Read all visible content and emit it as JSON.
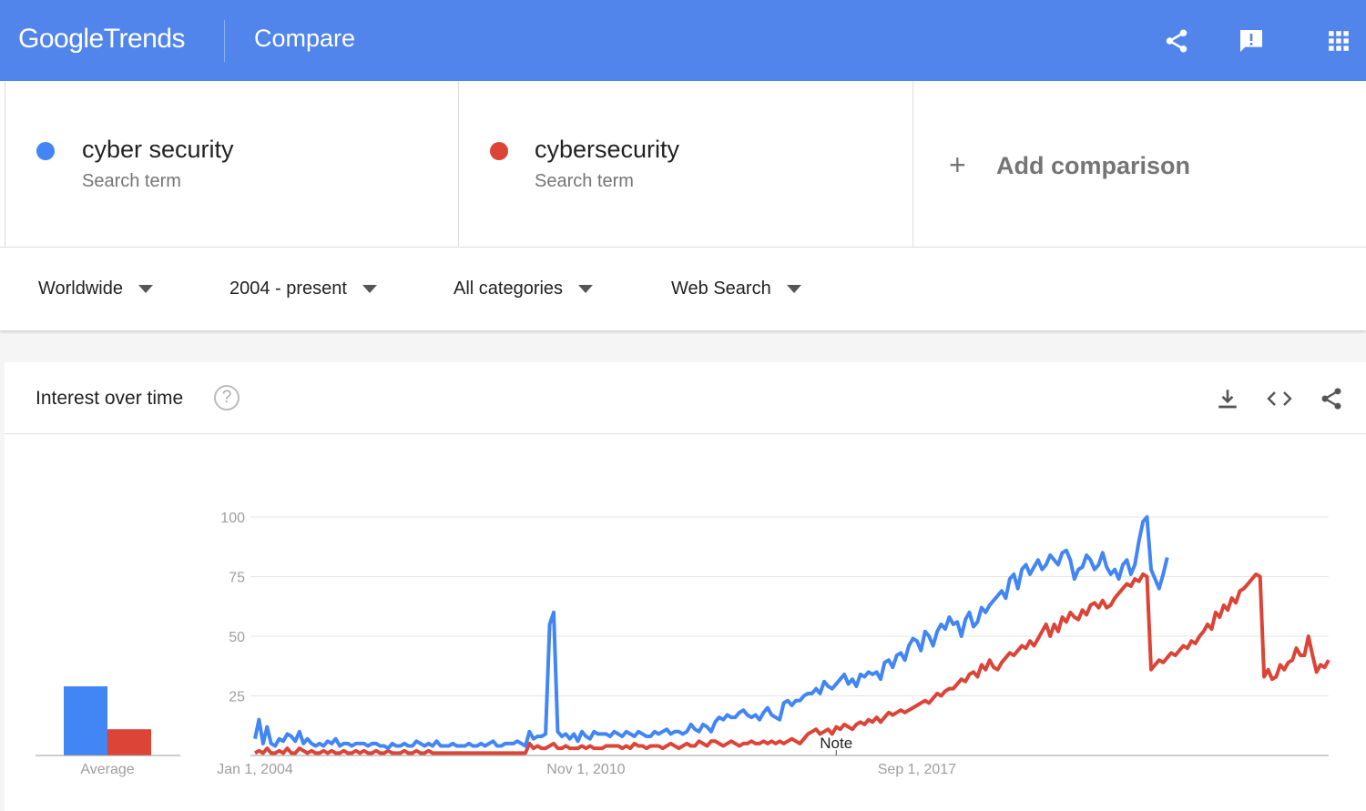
{
  "app": {
    "logo_google": "Google",
    "logo_trends": "Trends",
    "page_title": "Compare"
  },
  "top_icons": [
    "share-icon",
    "feedback-icon",
    "apps-grid-icon"
  ],
  "terms": [
    {
      "name": "cyber security",
      "type": "Search term",
      "color": "#4285f4"
    },
    {
      "name": "cybersecurity",
      "type": "Search term",
      "color": "#db4437"
    }
  ],
  "add_comparison": {
    "label": "Add comparison"
  },
  "filters": {
    "region": "Worldwide",
    "time": "2004 - present",
    "category": "All categories",
    "property": "Web Search"
  },
  "panel": {
    "title": "Interest over time",
    "help": "?"
  },
  "chart_data": {
    "type": "line",
    "title": "",
    "y_ticks": [
      25,
      50,
      75,
      100
    ],
    "ylim": [
      0,
      100
    ],
    "x_tick_labels": [
      "Jan 1, 2004",
      "Nov 1, 2010",
      "Sep 1, 2017"
    ],
    "x_tick_positions": [
      0,
      82,
      164
    ],
    "average_label": "Average",
    "note_label": "Note",
    "note_index": 144,
    "averages": [
      29,
      11
    ],
    "series": [
      {
        "name": "cyber security",
        "color": "#4285f4",
        "values": [
          7,
          15,
          5,
          12,
          5,
          4,
          7,
          6,
          9,
          8,
          6,
          10,
          5,
          7,
          5,
          4,
          5,
          4,
          6,
          5,
          7,
          4,
          5,
          5,
          4,
          5,
          5,
          5,
          4,
          5,
          5,
          4,
          4,
          3,
          5,
          4,
          4,
          5,
          4,
          4,
          6,
          5,
          4,
          5,
          4,
          6,
          4,
          4,
          4,
          5,
          4,
          4,
          4,
          5,
          4,
          4,
          5,
          4,
          5,
          6,
          4,
          4,
          5,
          5,
          5,
          6,
          5,
          4,
          10,
          7,
          8,
          8,
          9,
          55,
          60,
          10,
          8,
          9,
          7,
          9,
          6,
          10,
          8,
          7,
          10,
          9,
          9,
          9,
          8,
          10,
          9,
          8,
          10,
          9,
          8,
          10,
          9,
          8,
          8,
          10,
          9,
          10,
          11,
          9,
          10,
          10,
          9,
          10,
          13,
          11,
          10,
          13,
          12,
          10,
          14,
          16,
          15,
          17,
          16,
          16,
          18,
          19,
          17,
          16,
          17,
          15,
          18,
          20,
          17,
          16,
          15,
          22,
          23,
          21,
          23,
          23,
          25,
          26,
          26,
          28,
          26,
          31,
          29,
          28,
          30,
          32,
          34,
          30,
          32,
          29,
          34,
          33,
          35,
          34,
          35,
          32,
          39,
          40,
          37,
          42,
          43,
          40,
          46,
          49,
          48,
          44,
          52,
          50,
          46,
          52,
          55,
          53,
          58,
          55,
          56,
          50,
          57,
          60,
          54,
          56,
          62,
          60,
          63,
          65,
          67,
          69,
          66,
          74,
          76,
          70,
          78,
          80,
          76,
          79,
          82,
          78,
          80,
          84,
          82,
          80,
          85,
          86,
          82,
          74,
          78,
          79,
          84,
          82,
          78,
          80,
          85,
          79,
          76,
          78,
          74,
          80,
          82,
          76,
          80,
          90,
          98,
          100,
          78,
          74,
          70,
          76,
          83
        ],
        "x_values_note": ""
      },
      {
        "name": "cybersecurity",
        "color": "#db4437",
        "values": [
          1,
          2,
          1,
          3,
          1,
          1,
          2,
          1,
          3,
          1,
          1,
          3,
          2,
          1,
          2,
          1,
          1,
          2,
          1,
          2,
          1,
          1,
          2,
          1,
          1,
          2,
          1,
          2,
          1,
          1,
          2,
          1,
          1,
          2,
          1,
          1,
          1,
          2,
          1,
          1,
          2,
          1,
          1,
          2,
          1,
          1,
          1,
          1,
          1,
          1,
          1,
          1,
          1,
          1,
          1,
          1,
          1,
          1,
          1,
          1,
          1,
          1,
          1,
          1,
          1,
          1,
          1,
          1,
          5,
          3,
          4,
          3,
          3,
          4,
          5,
          3,
          3,
          4,
          3,
          3,
          3,
          4,
          3,
          4,
          3,
          3,
          3,
          4,
          4,
          4,
          4,
          3,
          4,
          3,
          5,
          4,
          4,
          3,
          4,
          4,
          4,
          3,
          4,
          5,
          4,
          3,
          4,
          5,
          4,
          4,
          6,
          5,
          4,
          6,
          6,
          5,
          4,
          5,
          6,
          5,
          4,
          5,
          5,
          6,
          5,
          5,
          6,
          5,
          6,
          5,
          6,
          5,
          6,
          7,
          6,
          5,
          7,
          9,
          10,
          11,
          9,
          10,
          11,
          9,
          12,
          11,
          13,
          12,
          11,
          13,
          14,
          13,
          15,
          14,
          16,
          14,
          16,
          18,
          17,
          18,
          19,
          18,
          19,
          20,
          21,
          22,
          23,
          22,
          24,
          26,
          25,
          27,
          28,
          28,
          30,
          32,
          31,
          34,
          35,
          33,
          38,
          36,
          40,
          37,
          36,
          39,
          41,
          43,
          42,
          44,
          46,
          45,
          48,
          46,
          49,
          52,
          55,
          50,
          55,
          52,
          58,
          56,
          60,
          58,
          57,
          61,
          59,
          63,
          64,
          62,
          65,
          62,
          63,
          66,
          68,
          70,
          72,
          71,
          74,
          73,
          76,
          75,
          36,
          38,
          40,
          39,
          41,
          43,
          42,
          44,
          46,
          45,
          48,
          47,
          50,
          52,
          55,
          53,
          60,
          58,
          63,
          61,
          66,
          64,
          69,
          70,
          72,
          74,
          76,
          75,
          33,
          36,
          32,
          33,
          38,
          36,
          39,
          40,
          45,
          42,
          42,
          50,
          42,
          35,
          38,
          37,
          40
        ]
      }
    ]
  }
}
